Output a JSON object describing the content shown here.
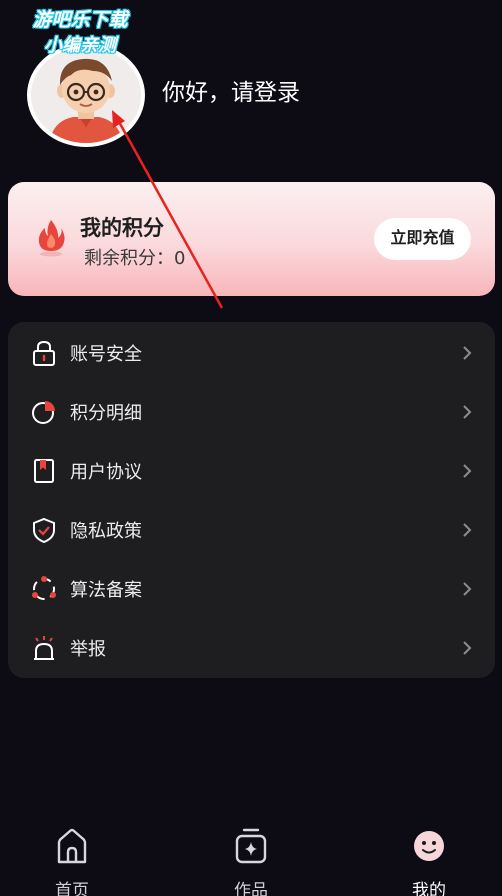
{
  "watermark": {
    "line1": "游吧乐下载",
    "line2": "小编亲测"
  },
  "profile": {
    "login_text": "你好，请登录"
  },
  "points": {
    "title": "我的积分",
    "remaining": "剩余积分：0",
    "recharge_label": "立即充值"
  },
  "menu": {
    "items": [
      {
        "label": "账号安全",
        "icon": "lock-icon"
      },
      {
        "label": "积分明细",
        "icon": "pie-chart-icon"
      },
      {
        "label": "用户协议",
        "icon": "bookmark-document-icon"
      },
      {
        "label": "隐私政策",
        "icon": "shield-check-icon"
      },
      {
        "label": "算法备案",
        "icon": "network-nodes-icon"
      },
      {
        "label": "举报",
        "icon": "alarm-bell-icon"
      }
    ]
  },
  "tabbar": {
    "tabs": [
      {
        "label": "首页",
        "icon": "home-icon"
      },
      {
        "label": "作品",
        "icon": "works-sparkle-icon"
      },
      {
        "label": "我的",
        "icon": "smiley-face-icon",
        "active": true
      }
    ]
  },
  "colors": {
    "background": "#0d0b14",
    "card_dark": "#1e1e21",
    "accent_red": "#e8453c",
    "points_gradient_end": "#f7b6ba"
  }
}
